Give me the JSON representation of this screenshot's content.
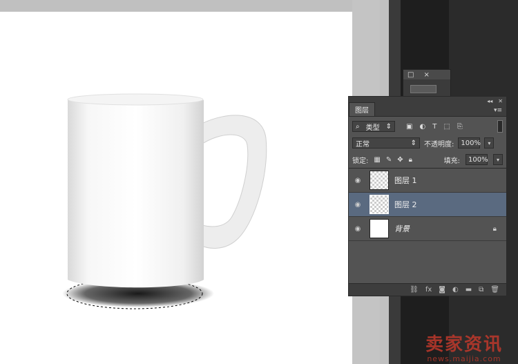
{
  "layers_panel": {
    "tab_label": "图层",
    "filter_type": "类型",
    "blend_mode": "正常",
    "opacity_label": "不透明度:",
    "opacity_value": "100%",
    "lock_label": "锁定:",
    "fill_label": "填充:",
    "fill_value": "100%",
    "layers": [
      {
        "name": "图层 1",
        "thumb": "checker",
        "selected": false,
        "visible": true
      },
      {
        "name": "图层 2",
        "thumb": "checker",
        "selected": true,
        "visible": true
      },
      {
        "name": "背景",
        "thumb": "white",
        "selected": false,
        "visible": true,
        "locked": true
      }
    ]
  },
  "mini_panel": {
    "close_glyph": "×",
    "restore_glyph": "□"
  },
  "watermark": {
    "text": "卖家资讯",
    "url": "news.maijia.com"
  },
  "colors": {
    "selected_layer": "#5a6a80",
    "panel_bg": "#535353",
    "workspace": "#2b2b2b",
    "watermark": "#c0392b"
  }
}
